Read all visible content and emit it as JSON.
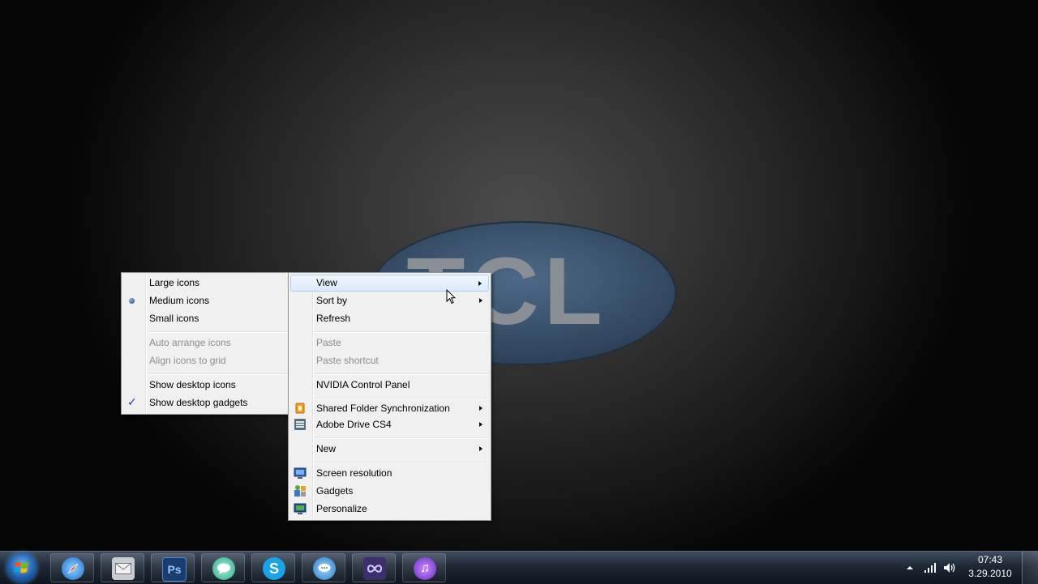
{
  "wallpaper": {
    "logo_text": "TCL"
  },
  "context_menu": {
    "items": [
      {
        "label": "View"
      },
      {
        "label": "Sort by"
      },
      {
        "label": "Refresh"
      },
      {
        "label": "Paste"
      },
      {
        "label": "Paste shortcut"
      },
      {
        "label": "NVIDIA Control Panel"
      },
      {
        "label": "Shared Folder Synchronization"
      },
      {
        "label": "Adobe Drive CS4"
      },
      {
        "label": "New"
      },
      {
        "label": "Screen resolution"
      },
      {
        "label": "Gadgets"
      },
      {
        "label": "Personalize"
      }
    ]
  },
  "view_submenu": {
    "items": [
      {
        "label": "Large icons"
      },
      {
        "label": "Medium icons"
      },
      {
        "label": "Small icons"
      },
      {
        "label": "Auto arrange icons"
      },
      {
        "label": "Align icons to grid"
      },
      {
        "label": "Show desktop icons"
      },
      {
        "label": "Show desktop gadgets"
      }
    ]
  },
  "taskbar": {
    "pinned": [
      {
        "name": "safari",
        "glyph": ""
      },
      {
        "name": "mail",
        "glyph": ""
      },
      {
        "name": "photoshop",
        "glyph": "Ps"
      },
      {
        "name": "messenger",
        "glyph": ""
      },
      {
        "name": "skype",
        "glyph": "S"
      },
      {
        "name": "chat",
        "glyph": ""
      },
      {
        "name": "connector",
        "glyph": ""
      },
      {
        "name": "itunes",
        "glyph": "♫"
      }
    ],
    "clock": {
      "time": "07:43",
      "date": "3.29.2010"
    }
  },
  "colors": {
    "menu_bg": "#f0f0f0",
    "menu_border": "#979797",
    "hover_bg": "#dbe9fb",
    "taskbar_bg": "#1d2835",
    "logo_fill": "#3e5773"
  }
}
